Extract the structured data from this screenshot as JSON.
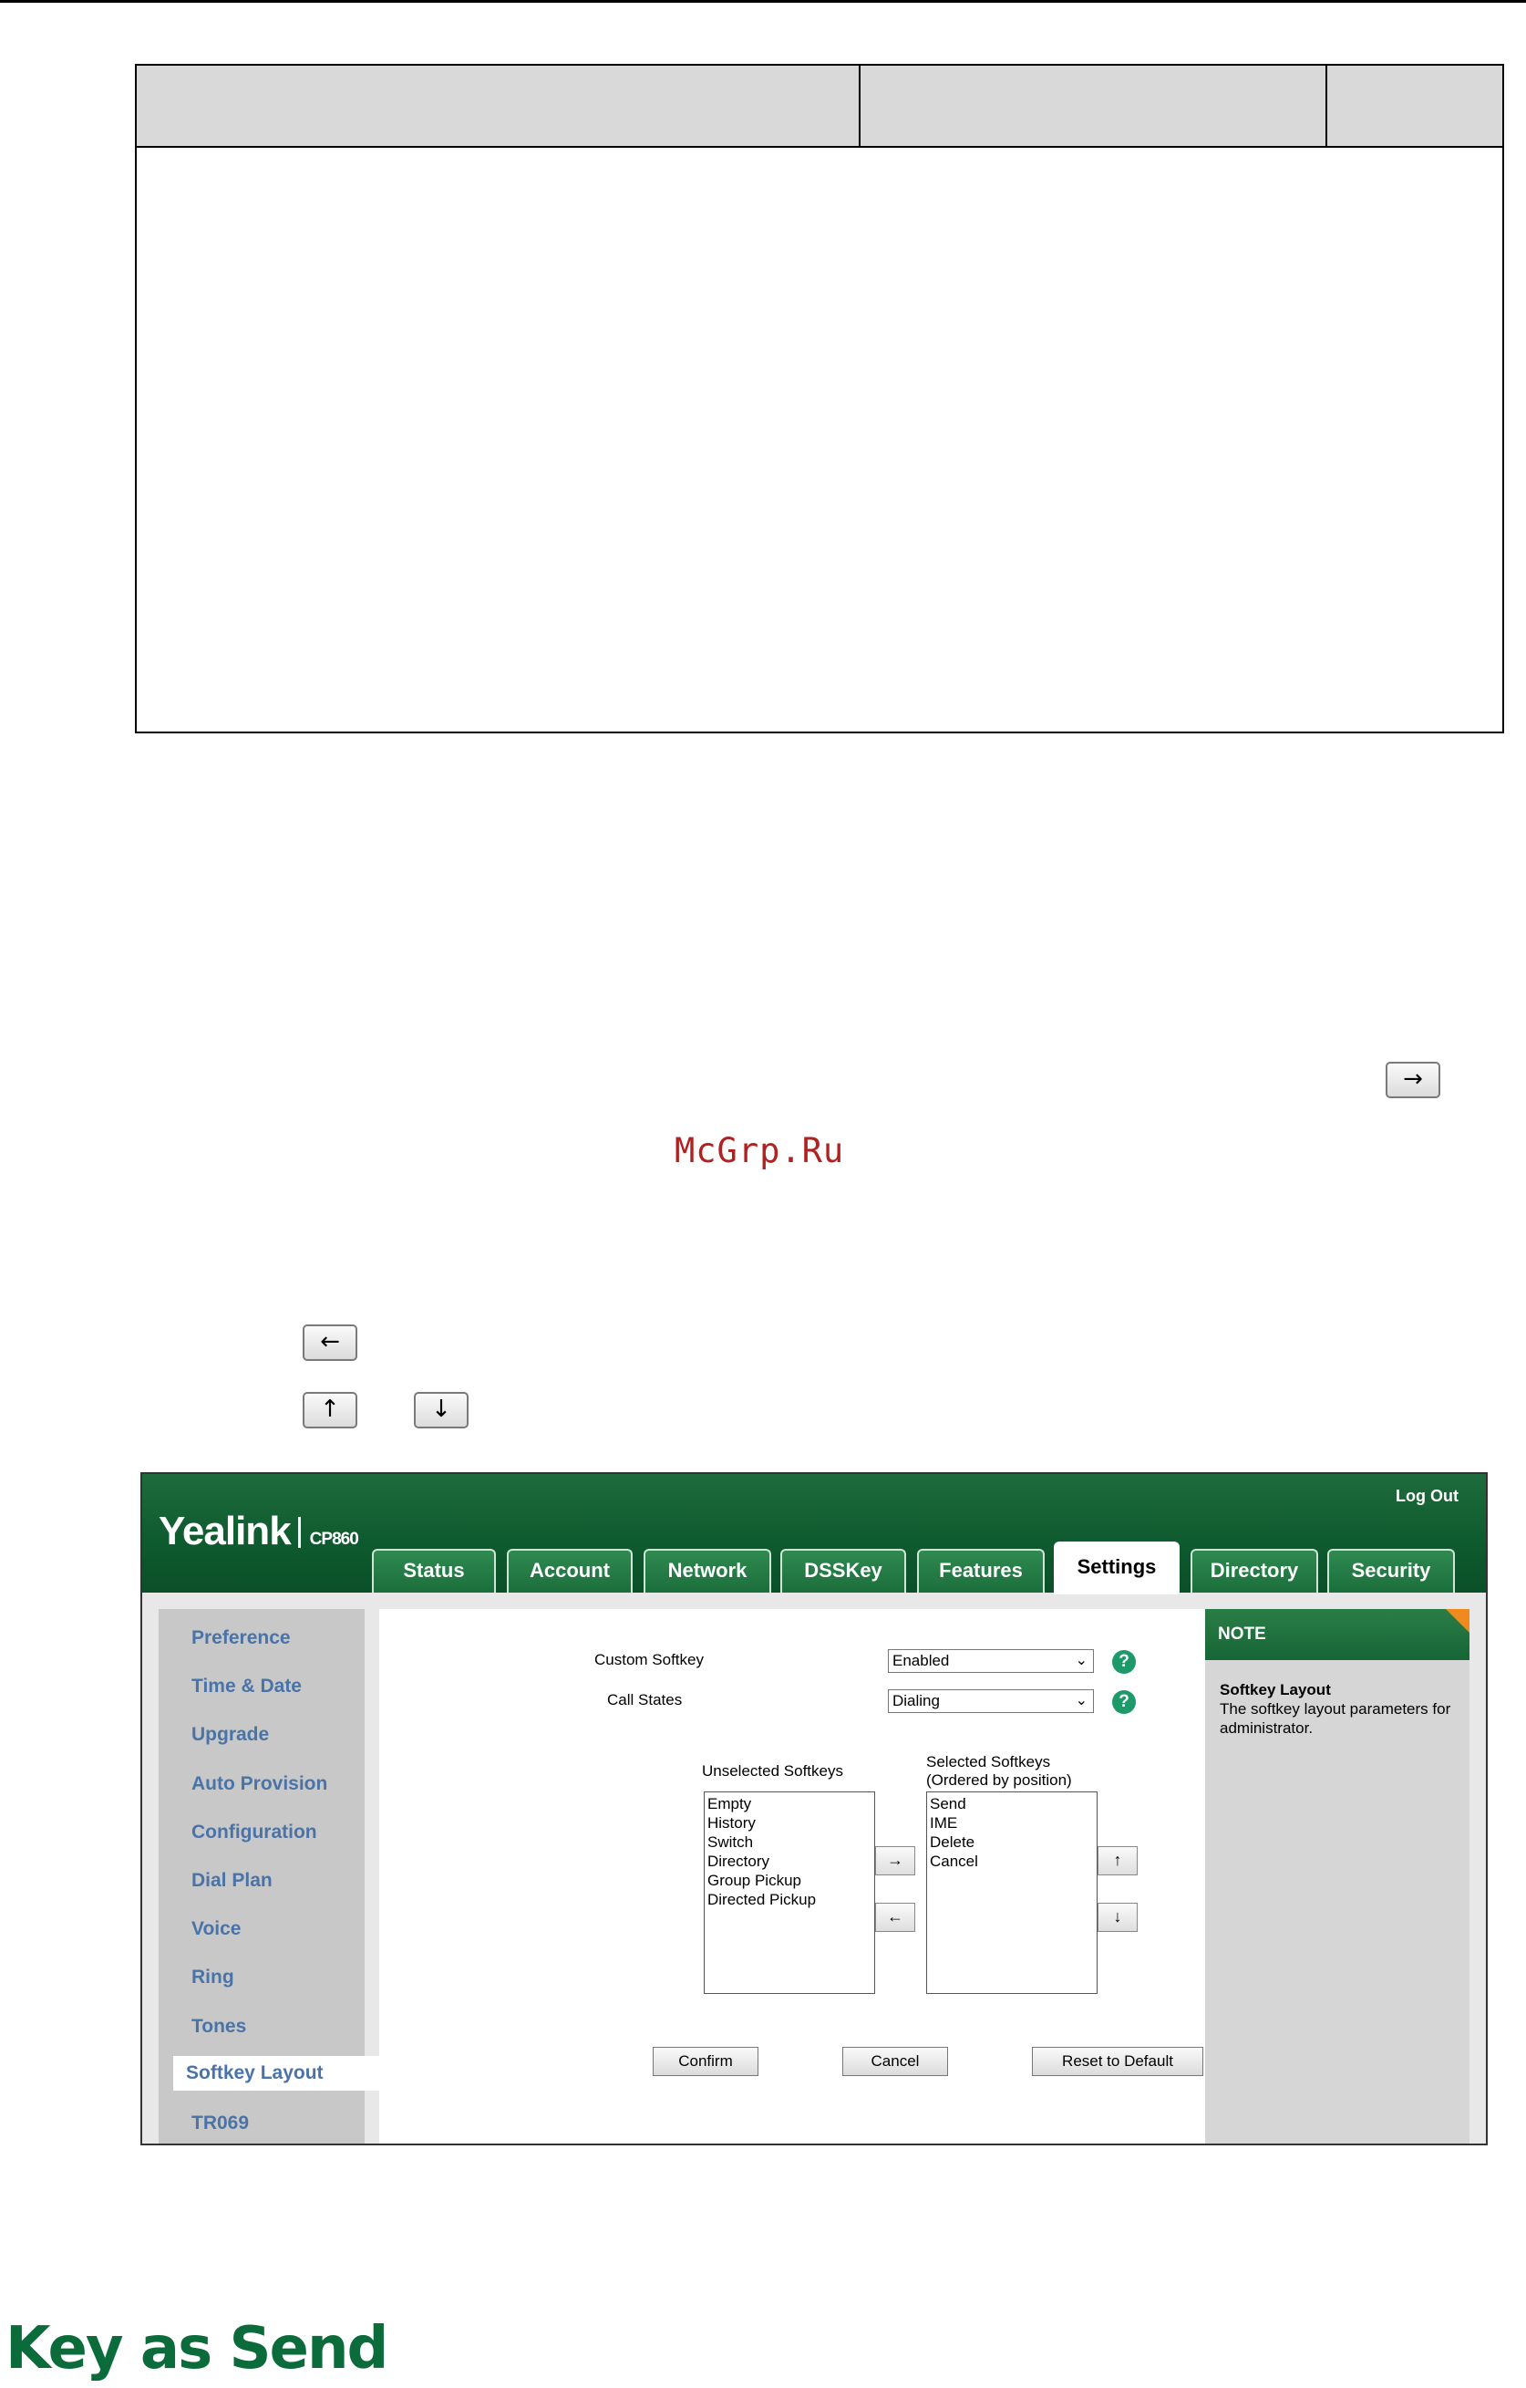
{
  "watermark": "McGrp.Ru",
  "text_buttons": {
    "right_arrow": "→",
    "left_arrow": "←",
    "up_arrow": "↑",
    "down_arrow": "↓"
  },
  "screenshot": {
    "logo": "Yealink",
    "model": "CP860",
    "logout": "Log Out",
    "tabs": [
      "Status",
      "Account",
      "Network",
      "DSSKey",
      "Features",
      "Settings",
      "Directory",
      "Security"
    ],
    "active_tab": "Settings",
    "sidebar": [
      "Preference",
      "Time & Date",
      "Upgrade",
      "Auto Provision",
      "Configuration",
      "Dial Plan",
      "Voice",
      "Ring",
      "Tones",
      "Softkey Layout",
      "TR069"
    ],
    "active_sidebar": "Softkey Layout",
    "custom_softkey_label": "Custom Softkey",
    "custom_softkey_value": "Enabled",
    "call_states_label": "Call States",
    "call_states_value": "Dialing",
    "help_icon": "?",
    "unselected_label": "Unselected Softkeys",
    "selected_label_1": "Selected Softkeys",
    "selected_label_2": "(Ordered by position)",
    "unselected": [
      "Empty",
      "History",
      "Switch",
      "Directory",
      "Group Pickup",
      "Directed Pickup"
    ],
    "selected": [
      "Send",
      "IME",
      "Delete",
      "Cancel"
    ],
    "buttons": {
      "confirm": "Confirm",
      "cancel": "Cancel",
      "reset": "Reset to Default"
    },
    "note": {
      "title": "NOTE",
      "heading": "Softkey Layout",
      "body": "The softkey layout parameters for administrator."
    }
  },
  "section_heading": "Key as Send",
  "colors": {
    "brand_green": "#0e5a2f",
    "heading_green": "#0b6b3a",
    "watermark_red": "#b22020",
    "note_accent": "#f08a1c"
  }
}
